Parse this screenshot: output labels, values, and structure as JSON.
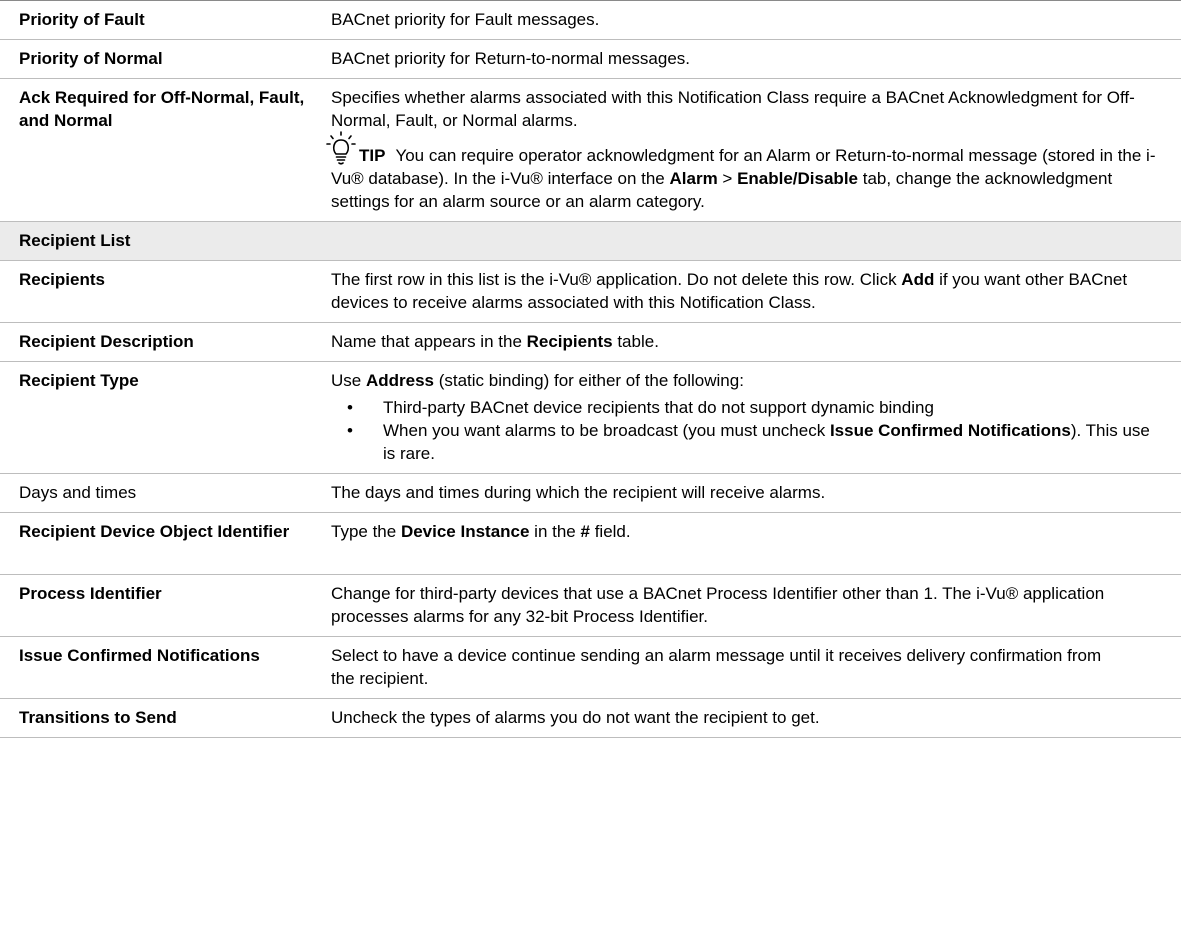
{
  "rows": {
    "priority_fault": {
      "label": "Priority of Fault",
      "desc": "BACnet priority for Fault messages."
    },
    "priority_normal": {
      "label": "Priority of Normal",
      "desc": "BACnet priority for Return-to-normal messages."
    },
    "ack_required": {
      "label": "Ack Required for Off-Normal, Fault, and Normal",
      "desc": "Specifies whether alarms associated with this Notification Class require a BACnet Acknowledgment for Off-Normal, Fault, or Normal alarms.",
      "tip": {
        "icon": "lightbulb-icon",
        "label": "TIP",
        "text_1": "You can require operator acknowledgment for an Alarm or Return-to-normal message (stored in the i-Vu® database). In the i-Vu® interface on the ",
        "bold_1": "Alarm",
        "sep": " > ",
        "bold_2": "Enable/Disable",
        "text_2": " tab, change the acknowledgment settings for an alarm source or an alarm category."
      }
    },
    "recipient_list": {
      "label": "Recipient List"
    },
    "recipients": {
      "label": "Recipients",
      "desc_1": "The first row in this list is the i-Vu® application. Do not delete this row. Click ",
      "bold_1": "Add",
      "desc_2": " if you want other BACnet devices to receive alarms associated with this Notification Class."
    },
    "recipient_description": {
      "label": "Recipient Description",
      "desc_1": "Name that appears in the ",
      "bold_1": "Recipients",
      "desc_2": " table."
    },
    "recipient_type": {
      "label": "Recipient Type",
      "desc_1": "Use ",
      "bold_1": "Address",
      "desc_2": " (static binding) for either of the following:",
      "bullet_1": "Third-party BACnet device recipients that do not support dynamic binding",
      "bullet_2_a": "When you want alarms to be broadcast (you must uncheck ",
      "bullet_2_bold": "Issue Confirmed Notifications",
      "bullet_2_b": "). This use is rare."
    },
    "days_times": {
      "label": "Days and times",
      "desc": "The days and times during which the recipient will receive alarms."
    },
    "device_object_id": {
      "label": "Recipient Device Object Identifier",
      "desc_1": "Type the ",
      "bold_1": "Device Instance",
      "desc_2": " in the ",
      "bold_2": "#",
      "desc_3": " field."
    },
    "process_identifier": {
      "label": "Process Identifier",
      "desc": "Change for third-party devices that use a BACnet Process Identifier other than 1. The i-Vu® application processes alarms for any 32-bit Process Identifier."
    },
    "issue_confirmed": {
      "label": "Issue Confirmed Notifications",
      "desc": "Select to have a device continue sending an alarm message until it receives delivery confirmation from the recipient."
    },
    "transitions": {
      "label": "Transitions to Send",
      "desc": "Uncheck the types of alarms you do not want the recipient to get."
    }
  }
}
